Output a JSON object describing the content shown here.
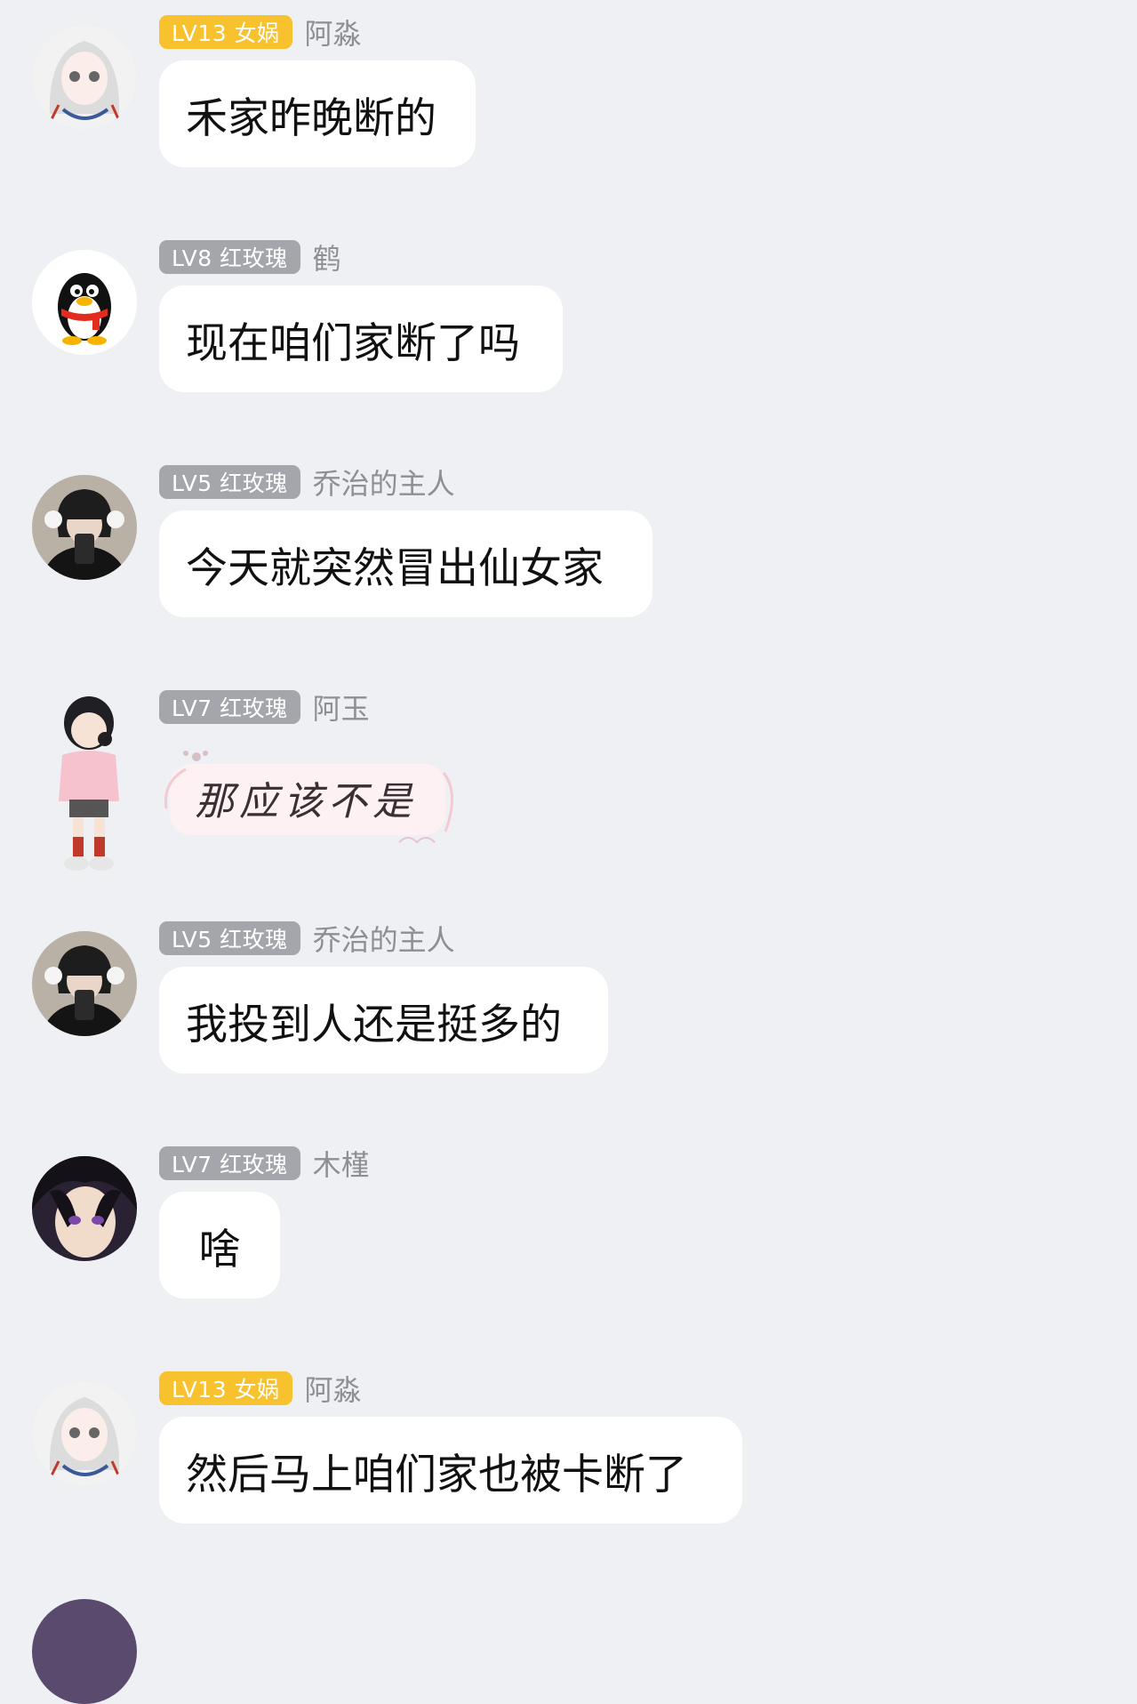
{
  "messages": [
    {
      "level": "LV13 女娲",
      "badge": "gold",
      "user": "阿淼",
      "text": "禾家昨晚断的",
      "avatar": "anime-girl-white-hair-avatar"
    },
    {
      "level": "LV8 红玫瑰",
      "badge": "gray",
      "user": "鹤",
      "text": "现在咱们家断了吗",
      "avatar": "qq-penguin-avatar"
    },
    {
      "level": "LV5 红玫瑰",
      "badge": "gray",
      "user": "乔治的主人",
      "text": "今天就突然冒出仙女家",
      "avatar": "mirror-selfie-avatar"
    },
    {
      "level": "LV7 红玫瑰",
      "badge": "gray",
      "user": "阿玉",
      "text": "那应该不是",
      "avatar": "chibi-girl-avatar",
      "sticker": true
    },
    {
      "level": "LV5 红玫瑰",
      "badge": "gray",
      "user": "乔治的主人",
      "text": "我投到人还是挺多的",
      "avatar": "mirror-selfie-avatar"
    },
    {
      "level": "LV7 红玫瑰",
      "badge": "gray",
      "user": "木槿",
      "text": "啥",
      "avatar": "anime-boy-avatar"
    },
    {
      "level": "LV13 女娲",
      "badge": "gold",
      "user": "阿淼",
      "text": "然后马上咱们家也被卡断了",
      "avatar": "anime-girl-white-hair-avatar"
    }
  ],
  "colors": {
    "background": "#eef0f3",
    "bubble": "#ffffff",
    "badge_gold": "#f8c22e",
    "badge_gray": "#a4a6ab",
    "username": "#8d8f94"
  }
}
